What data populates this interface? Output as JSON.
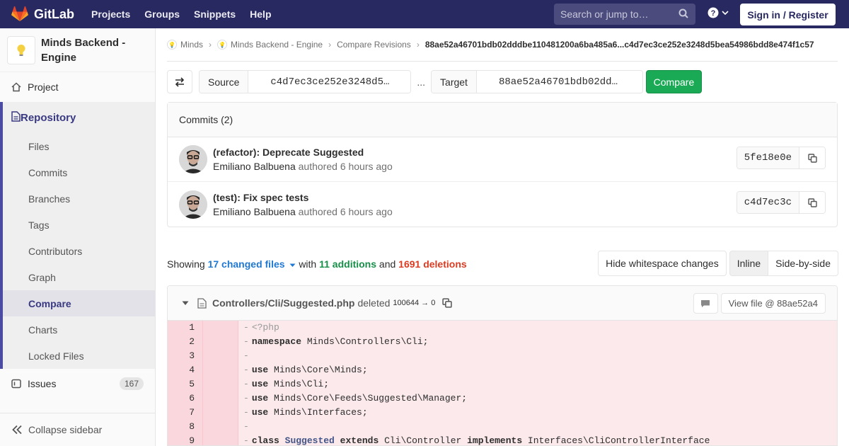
{
  "header": {
    "brand": "GitLab",
    "nav": [
      "Projects",
      "Groups",
      "Snippets",
      "Help"
    ],
    "search_placeholder": "Search or jump to…",
    "signin_label": "Sign in / Register"
  },
  "sidebar": {
    "project_name": "Minds Backend - Engine",
    "project_label": "Project",
    "repository_label": "Repository",
    "repo_items": [
      "Files",
      "Commits",
      "Branches",
      "Tags",
      "Contributors",
      "Graph",
      "Compare",
      "Charts",
      "Locked Files"
    ],
    "active_item": "Compare",
    "issues_label": "Issues",
    "issues_count": "167",
    "collapse_label": "Collapse sidebar"
  },
  "breadcrumb": [
    "Minds",
    "Minds Backend - Engine",
    "Compare Revisions",
    "88ae52a46701bdb02dddbe110481200a6ba485a6...c4d7ec3ce252e3248d5bea54986bdd8e474f1c57"
  ],
  "compare": {
    "source_label": "Source",
    "source_value": "c4d7ec3ce252e3248d5…",
    "separator": "...",
    "target_label": "Target",
    "target_value": "88ae52a46701bdb02dd…",
    "button_label": "Compare"
  },
  "commits": {
    "header": "Commits (2)",
    "items": [
      {
        "title": "(refactor): Deprecate Suggested",
        "author": "Emiliano Balbuena",
        "verb": "authored",
        "time": "6 hours ago",
        "sha": "5fe18e0e"
      },
      {
        "title": "(test): Fix spec tests",
        "author": "Emiliano Balbuena",
        "verb": "authored",
        "time": "6 hours ago",
        "sha": "c4d7ec3c"
      }
    ]
  },
  "stats": {
    "showing": "Showing",
    "changed_files": "17 changed files",
    "with": "with",
    "additions": "11 additions",
    "and": "and",
    "deletions": "1691 deletions",
    "whitespace_btn": "Hide whitespace changes",
    "inline_btn": "Inline",
    "side_btn": "Side-by-side"
  },
  "file": {
    "path": "Controllers/Cli/Suggested.php",
    "status": "deleted",
    "mode": "100644 → 0",
    "view_file_label": "View file @ 88ae52a4"
  },
  "code_lines": [
    {
      "n": "1",
      "text": "<?php"
    },
    {
      "n": "2",
      "kw": "namespace",
      "text": " Minds\\Controllers\\Cli;"
    },
    {
      "n": "3",
      "text": ""
    },
    {
      "n": "4",
      "kw": "use",
      "text": " Minds\\Core\\Minds;"
    },
    {
      "n": "5",
      "kw": "use",
      "text": " Minds\\Cli;"
    },
    {
      "n": "6",
      "kw": "use",
      "text": " Minds\\Core\\Feeds\\Suggested\\Manager;"
    },
    {
      "n": "7",
      "kw": "use",
      "text": " Minds\\Interfaces;"
    },
    {
      "n": "8",
      "text": ""
    },
    {
      "n": "9",
      "kw": "class",
      "cls": "Suggested",
      "kw2": "extends",
      "mid": " Cli\\Controller ",
      "kw3": "implements",
      "text": " Interfaces\\CliControllerInterface"
    }
  ],
  "colors": {
    "topbar": "#292961",
    "green": "#1aaa55",
    "additions": "#168f48",
    "deletions": "#db3b21",
    "link": "#1f78d1"
  }
}
